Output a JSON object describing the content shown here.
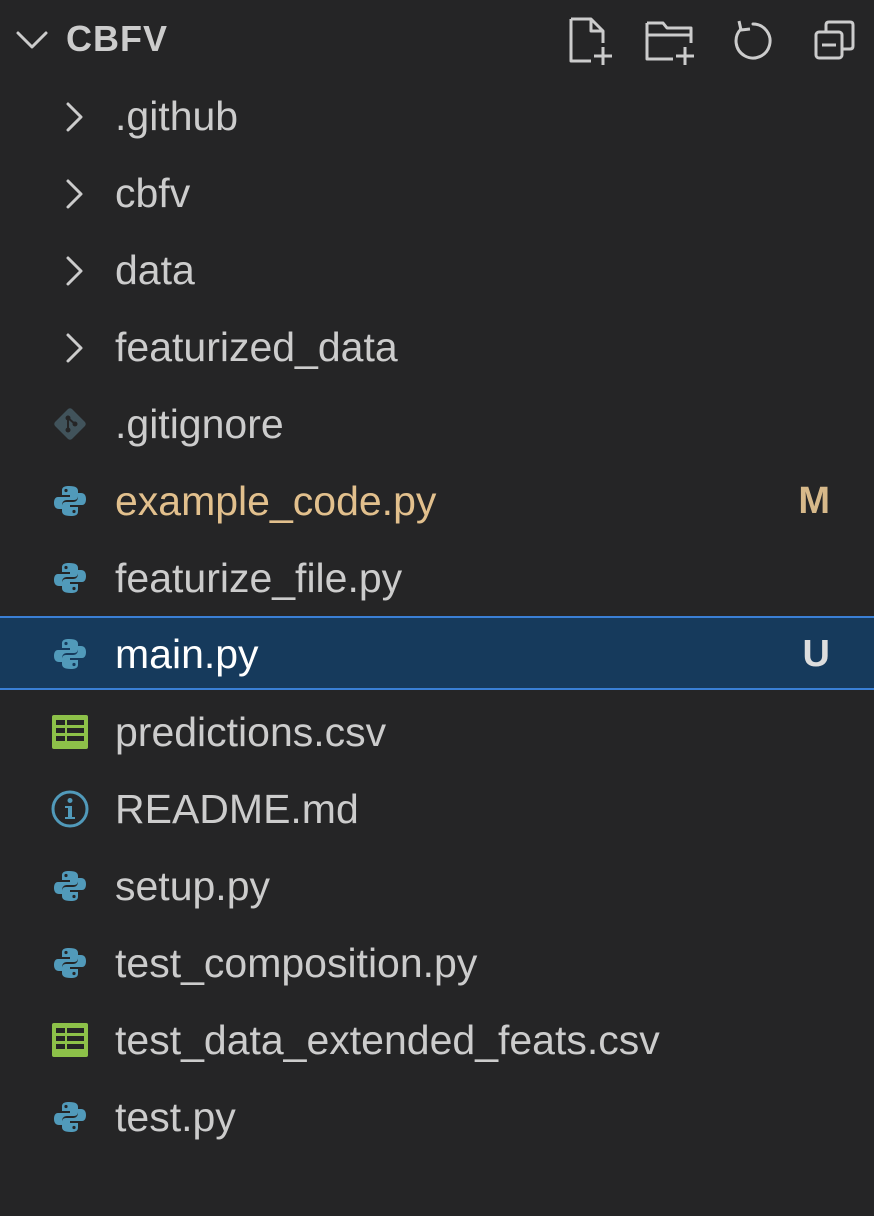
{
  "explorer": {
    "section_title": "CBFV",
    "actions": [
      {
        "name": "new-file",
        "icon": "new-file-icon"
      },
      {
        "name": "new-folder",
        "icon": "new-folder-icon"
      },
      {
        "name": "refresh",
        "icon": "refresh-icon"
      },
      {
        "name": "collapse-all",
        "icon": "collapse-all-icon"
      }
    ],
    "items": [
      {
        "label": ".github",
        "kind": "folder"
      },
      {
        "label": "cbfv",
        "kind": "folder"
      },
      {
        "label": "data",
        "kind": "folder"
      },
      {
        "label": "featurized_data",
        "kind": "folder"
      },
      {
        "label": ".gitignore",
        "kind": "git",
        "icon": "git-icon"
      },
      {
        "label": "example_code.py",
        "kind": "python",
        "icon": "python-icon",
        "badge": "M",
        "status": "modified"
      },
      {
        "label": "featurize_file.py",
        "kind": "python",
        "icon": "python-icon"
      },
      {
        "label": "main.py",
        "kind": "python",
        "icon": "python-icon",
        "badge": "U",
        "status": "untracked",
        "selected": true
      },
      {
        "label": "predictions.csv",
        "kind": "csv",
        "icon": "table-icon"
      },
      {
        "label": "README.md",
        "kind": "info",
        "icon": "info-icon"
      },
      {
        "label": "setup.py",
        "kind": "python",
        "icon": "python-icon"
      },
      {
        "label": "test_composition.py",
        "kind": "python",
        "icon": "python-icon"
      },
      {
        "label": "test_data_extended_feats.csv",
        "kind": "csv",
        "icon": "table-icon"
      },
      {
        "label": "test.py",
        "kind": "python",
        "icon": "python-icon"
      }
    ]
  },
  "colors": {
    "background": "#252526",
    "text": "#cccccc",
    "modified": "#e2c08d",
    "selected_bg": "#163a5c",
    "selected_border": "#3a7fd5",
    "python_icon": "#519aba",
    "csv_icon": "#8dc149"
  }
}
